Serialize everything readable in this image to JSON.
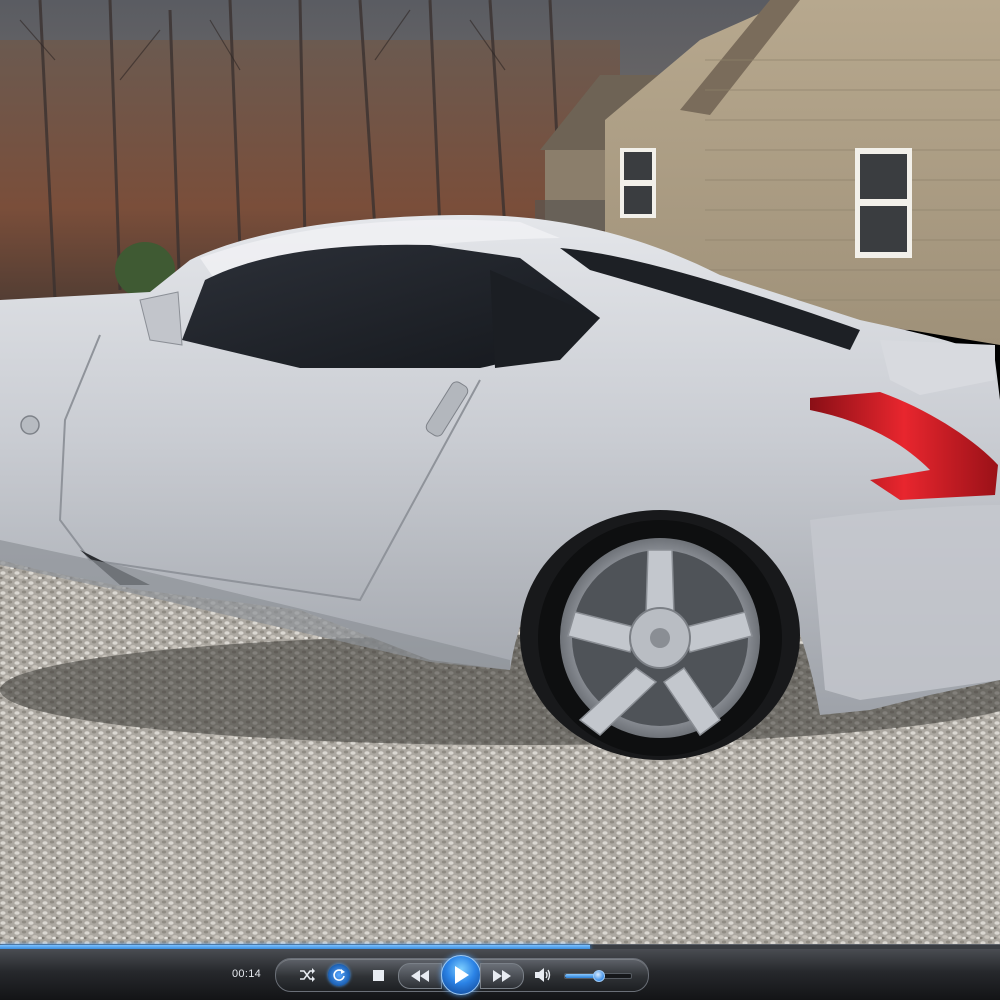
{
  "player": {
    "current_time": "00:14",
    "seek_progress": 0.59,
    "volume_level": 0.5,
    "accent_color": "#2a7fd6"
  },
  "controls": {
    "shuffle_icon": "shuffle-icon",
    "repeat_icon": "repeat-icon",
    "stop_icon": "stop-icon",
    "previous_icon": "rewind-icon",
    "play_icon": "play-icon",
    "next_icon": "fast-forward-icon",
    "volume_icon": "speaker-icon"
  }
}
